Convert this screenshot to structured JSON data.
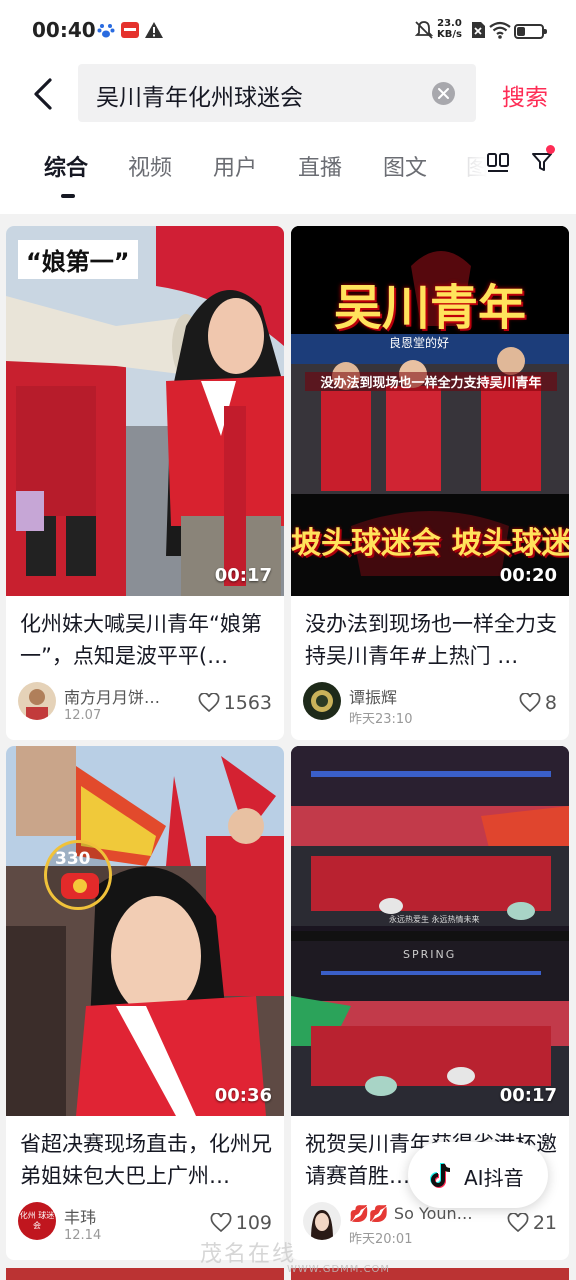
{
  "status_bar": {
    "time": "00:40",
    "net_speed_value": "23.0",
    "net_speed_unit": "KB/s",
    "battery_level": 0.35,
    "icons": [
      "baidu-paw-icon",
      "app-notification-icon",
      "warning-icon",
      "mute-bell-icon",
      "no-sim-icon",
      "wifi-icon",
      "battery-icon"
    ]
  },
  "search": {
    "query": "吴川青年化州球迷会",
    "submit_label": "搜索"
  },
  "tabs": {
    "items": [
      "综合",
      "视频",
      "用户",
      "直播",
      "图文",
      "图"
    ],
    "active_index": 0
  },
  "results": [
    {
      "thumb_caption": "“娘第一”",
      "duration": "00:17",
      "title": "化州妹大喊吴川青年“娘第一”，点知是波平平(…",
      "author": "南方月月饼…",
      "date": "12.07",
      "likes": "1563"
    },
    {
      "thumb_title_top": "吴川青年",
      "thumb_subtitle": "没办法到现场也一样全力支持吴川青年",
      "thumb_sign": "良恩堂的好",
      "thumb_title_bottom": "坡头球迷会 坡头球迷会",
      "duration": "00:20",
      "title": "没办法到现场也一样全力支持吴川青年#上热门 …",
      "author": "谭振辉",
      "date": "昨天23:10",
      "likes": "8"
    },
    {
      "badge_count": "330",
      "duration": "00:36",
      "title": "省超决赛现场直击，化州兄弟姐妹包大巴上广州…",
      "author": "丰玮",
      "avatar_text": "化州 球迷会",
      "date": "12.14",
      "likes": "109"
    },
    {
      "thumb_caption_1": "永远热爱生 永远热情未来",
      "thumb_caption_2": "SPRING",
      "duration": "00:17",
      "title": "祝贺吴川青年获得省港杯邀请赛首胜…",
      "author": "💋💋 So Youn…",
      "date": "昨天20:01",
      "likes": "21"
    }
  ],
  "ai_button": {
    "label": "AI抖音"
  },
  "watermark": {
    "text": "茂名在线",
    "url": "WWW.GDMM.COM"
  }
}
